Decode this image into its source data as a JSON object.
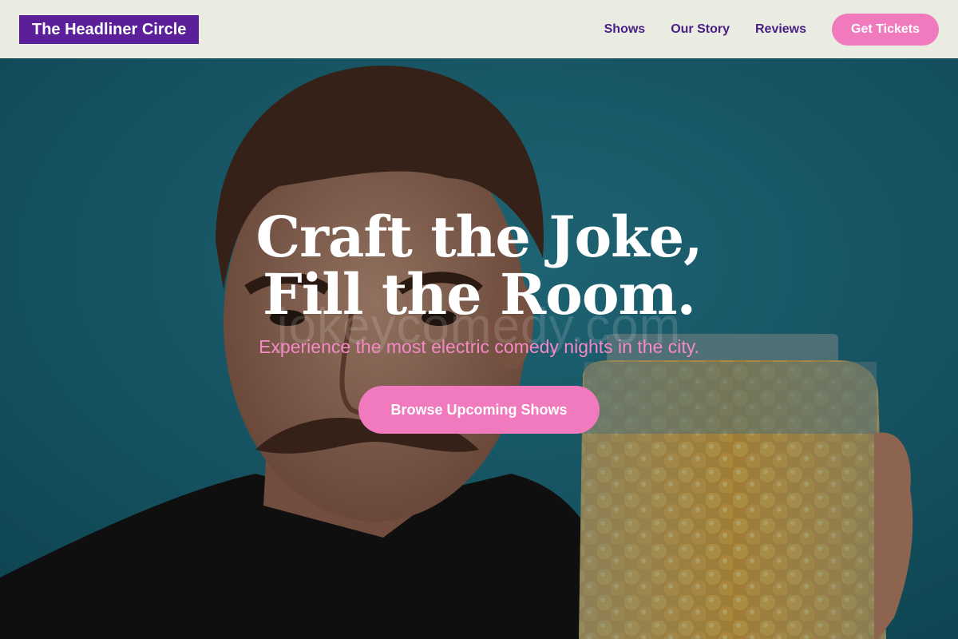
{
  "brand": {
    "name": "The Headliner Circle"
  },
  "nav": {
    "items": [
      {
        "label": "Shows"
      },
      {
        "label": "Our Story"
      },
      {
        "label": "Reviews"
      }
    ],
    "cta": "Get Tickets"
  },
  "hero": {
    "title_line1": "Craft the Joke,",
    "title_line2": "Fill the Room.",
    "subtitle": "Experience the most electric comedy nights in the city.",
    "cta": "Browse Upcoming Shows",
    "watermark": "jokeycomedy.com"
  },
  "colors": {
    "header_bg": "#eaece2",
    "logo_bg": "#5b1f9a",
    "nav_text": "#4b1e86",
    "accent_pink": "#f179bd",
    "subtitle_pink": "#f58ac4",
    "hero_bg": "#1f6f82"
  }
}
